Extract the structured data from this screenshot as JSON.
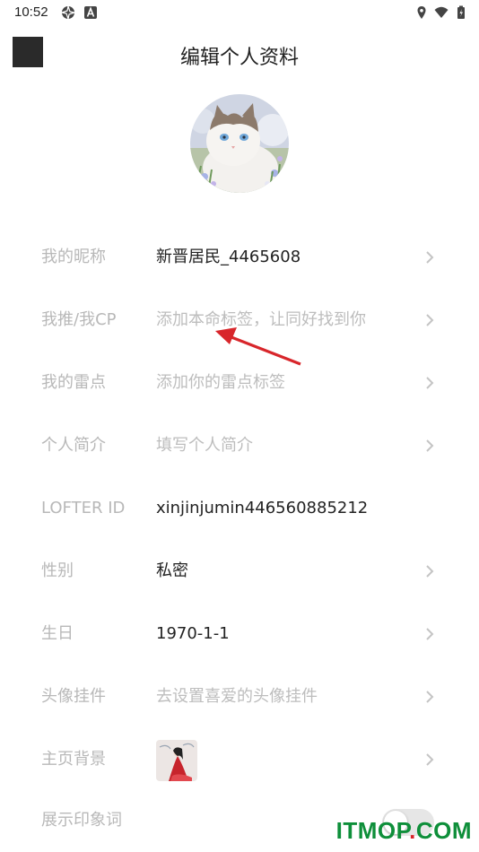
{
  "status_bar": {
    "time": "10:52"
  },
  "header": {
    "title": "编辑个人资料"
  },
  "profile": {
    "rows": [
      {
        "label": "我的昵称",
        "value": "新晋居民_4465608"
      },
      {
        "label": "我推/我CP",
        "value": "添加本命标签，让同好找到你"
      },
      {
        "label": "我的雷点",
        "value": "添加你的雷点标签"
      },
      {
        "label": "个人简介",
        "value": "填写个人简介"
      },
      {
        "label": "LOFTER ID",
        "value": "xinjinjumin446560885212"
      },
      {
        "label": "性别",
        "value": "私密"
      },
      {
        "label": "生日",
        "value": "1970-1-1"
      },
      {
        "label": "头像挂件",
        "value": "去设置喜爱的头像挂件"
      },
      {
        "label": "主页背景"
      },
      {
        "label": "展示印象词",
        "toggle_on": false
      }
    ]
  },
  "watermark": {
    "brand": "ITMOP",
    "dot": ".",
    "tld": "COM"
  }
}
